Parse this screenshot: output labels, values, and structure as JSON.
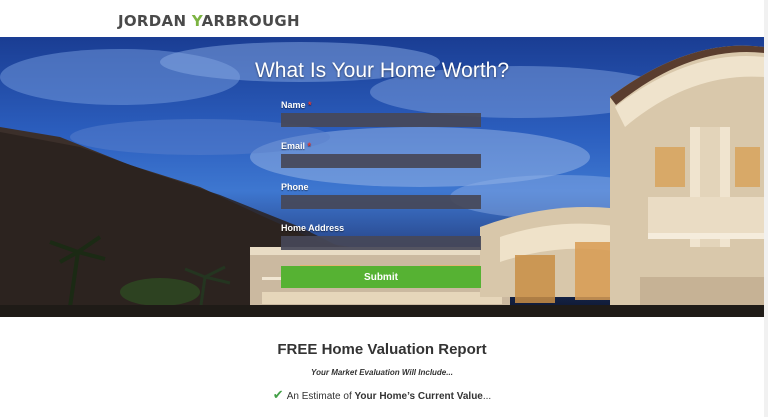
{
  "header": {
    "logo_first": "JORDAN",
    "logo_y": "Y",
    "logo_rest": "ARBROUGH"
  },
  "hero": {
    "title": "What Is Your Home Worth?"
  },
  "form": {
    "name_label": "Name",
    "email_label": "Email",
    "phone_label": "Phone",
    "address_label": "Home Address",
    "required_mark": "*",
    "submit_label": "Submit"
  },
  "report": {
    "title": "FREE Home Valuation Report",
    "subtitle": "Your Market Evaluation Will Include...",
    "bullets": [
      {
        "prefix": "An Estimate of ",
        "strong": "Your Home’s Current Value",
        "suffix": "..."
      }
    ]
  },
  "colors": {
    "accent_green": "#56b233",
    "logo_y_green": "#7cb342",
    "check_green": "#43a047"
  }
}
